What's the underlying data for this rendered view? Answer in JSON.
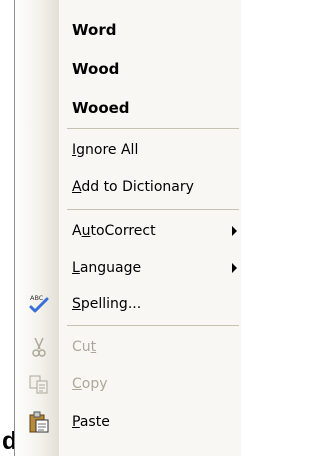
{
  "document": {
    "visible_fragment": "d"
  },
  "context_menu": {
    "suggestions": [
      "Word",
      "Wood",
      "Wooed"
    ],
    "ignore_all": {
      "label": "Ignore All",
      "mnemonic": "I"
    },
    "add_to_dictionary": {
      "label": "Add to Dictionary",
      "mnemonic": "A"
    },
    "autocorrect": {
      "label": "AutoCorrect",
      "mnemonic": "u",
      "has_submenu": true
    },
    "language": {
      "label": "Language",
      "mnemonic": "L",
      "has_submenu": true
    },
    "spelling": {
      "label": "Spelling...",
      "mnemonic": "S",
      "icon": "spell-check-icon"
    },
    "cut": {
      "label": "Cut",
      "mnemonic": "t",
      "icon": "scissors-icon",
      "enabled": false
    },
    "copy": {
      "label": "Copy",
      "mnemonic": "C",
      "icon": "copy-icon",
      "enabled": false
    },
    "paste": {
      "label": "Paste",
      "mnemonic": "P",
      "icon": "clipboard-icon",
      "enabled": true
    }
  },
  "colors": {
    "menu_background": "#f8f7f3",
    "disabled_text": "#aca899",
    "spelling_check": "#3a6fd8"
  }
}
